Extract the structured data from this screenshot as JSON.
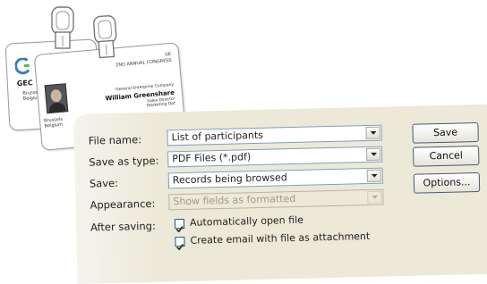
{
  "illustration": {
    "back_badge": {
      "logo_text": "GEC",
      "location": "Brussels\nBelgium"
    },
    "front_badge": {
      "event_line1": "GE",
      "event_line2": "2ND ANNUAL CONGRESS",
      "company": "General Enterprise Company",
      "name": "William Greenshare",
      "role": "Sales Director\nMarketing Dpt",
      "location": "Brussels\nBelgium"
    }
  },
  "dialog": {
    "file_name": {
      "label": "File name:",
      "value": "List of participants"
    },
    "save_as_type": {
      "label": "Save as type:",
      "value": "PDF Files (*.pdf)"
    },
    "save": {
      "label": "Save:",
      "value": "Records being browsed"
    },
    "appearance": {
      "label": "Appearance:",
      "value": "Show fields as formatted"
    },
    "after_saving": {
      "label": "After saving:",
      "options": [
        {
          "label": "Automatically open file",
          "checked": true
        },
        {
          "label": "Create email with file as attachment",
          "checked": true
        }
      ]
    },
    "buttons": {
      "save": "Save",
      "cancel": "Cancel",
      "options": "Options..."
    }
  }
}
